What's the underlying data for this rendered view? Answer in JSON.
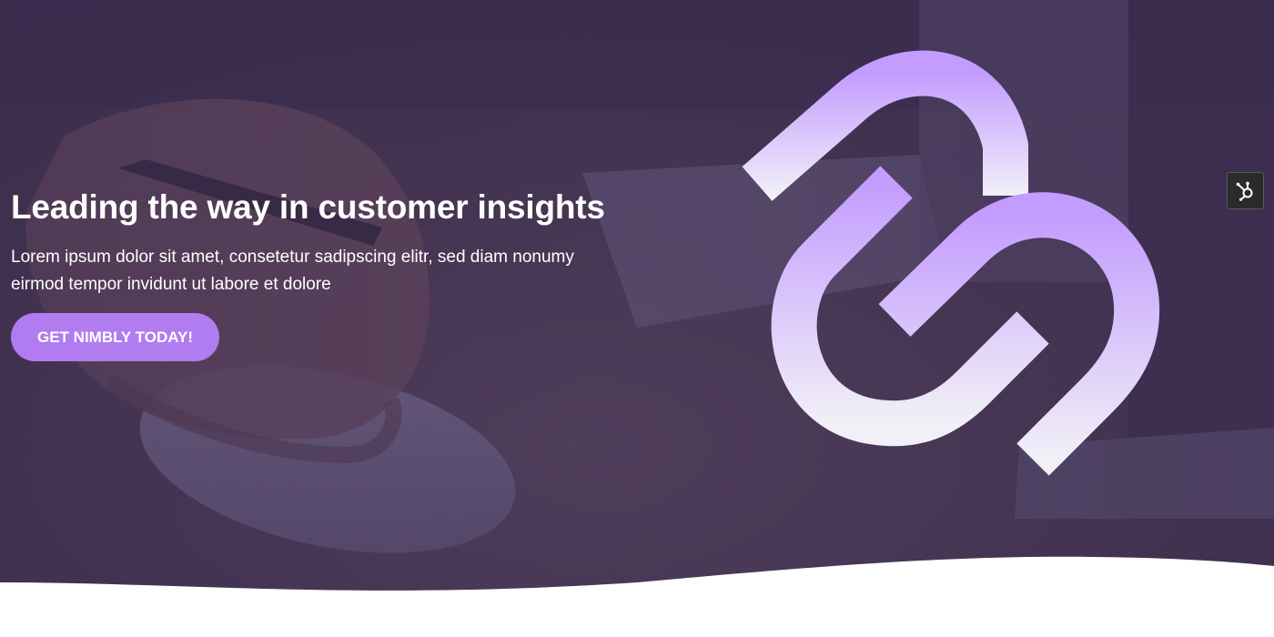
{
  "hero": {
    "title": "Leading the way in customer insights",
    "subtitle": "Lorem ipsum dolor sit amet, consetetur sadipscing elitr, sed diam nonumy eirmod tempor invidunt ut labore et dolore",
    "cta_label": "GET NIMBLY TODAY!"
  },
  "colors": {
    "accent": "#b07cf0",
    "overlay": "#3f3150",
    "logo_top": "#c39cff",
    "logo_bottom": "#f1f0f7",
    "widget": "#2b2b2b"
  },
  "icons": {
    "logo": "chain-link-logo-icon",
    "widget": "hubspot-sprocket-icon"
  }
}
